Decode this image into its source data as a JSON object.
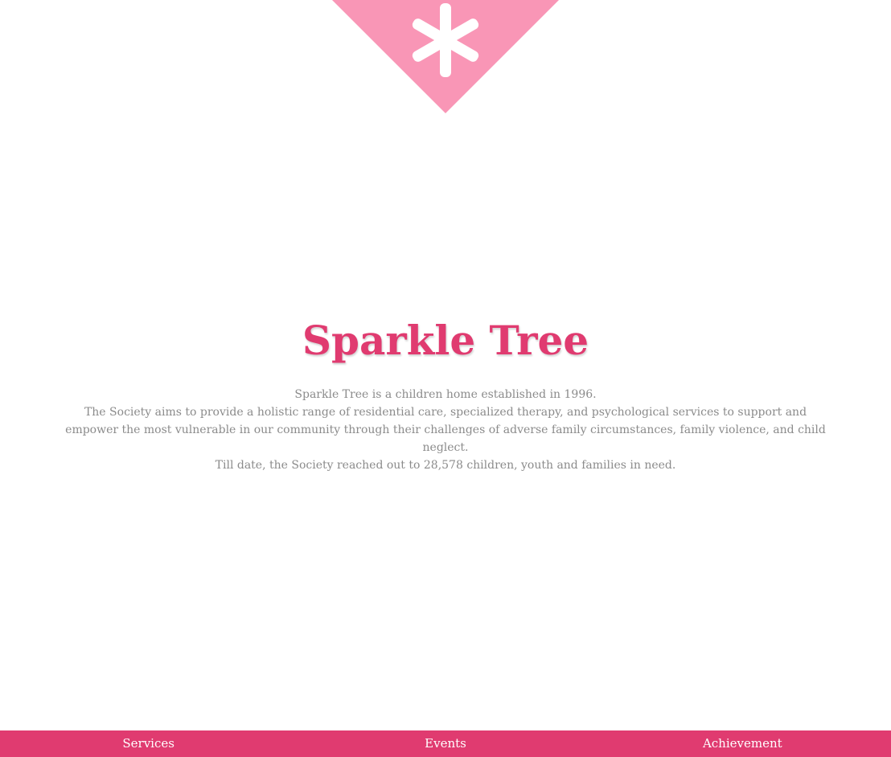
{
  "brand": {
    "logo_icon": "asterisk-icon",
    "logo_color": "#f996b6",
    "accent_color": "#e03b70"
  },
  "hero": {
    "title": "Sparkle Tree",
    "lines": [
      "Sparkle Tree is a children home established in 1996.",
      "The Society aims to provide a holistic range of residential care, specialized therapy, and psychological services to support and empower the most vulnerable in our community through their challenges of adverse family circumstances, family violence, and child neglect.",
      "Till date, the Society reached out to 28,578 children, youth and families in need."
    ]
  },
  "footer": {
    "links": [
      {
        "label": "Services"
      },
      {
        "label": "Events"
      },
      {
        "label": "Achievement"
      }
    ]
  }
}
